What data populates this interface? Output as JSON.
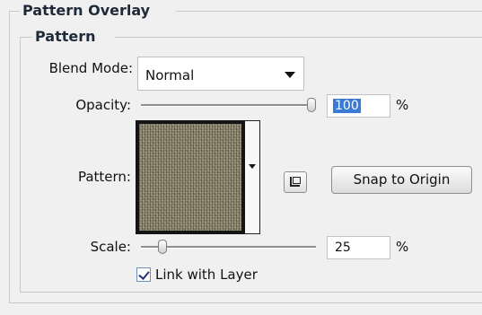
{
  "panel": {
    "title": "Pattern Overlay",
    "subgroup_title": "Pattern"
  },
  "blend_mode": {
    "label": "Blend Mode:",
    "value": "Normal"
  },
  "opacity": {
    "label": "Opacity:",
    "value": "100",
    "unit": "%",
    "slider_fraction": 1.0
  },
  "pattern": {
    "label": "Pattern:",
    "snap_label": "Snap to Origin",
    "new_preset_icon": "new-preset-icon",
    "swatch_color": "#8e8770"
  },
  "scale": {
    "label": "Scale:",
    "value": "25",
    "unit": "%",
    "slider_fraction": 0.1
  },
  "link_with_layer": {
    "label": "Link with Layer",
    "checked": true
  },
  "colors": {
    "background": "#f0f0f0",
    "selection": "#3a7bd5",
    "check": "#203a78"
  }
}
